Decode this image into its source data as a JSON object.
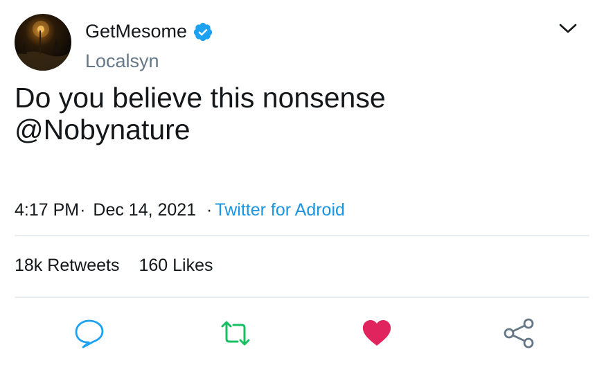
{
  "user": {
    "display_name": "GetMesome",
    "handle": "Localsyn",
    "verified": true,
    "avatar_icon": "avatar-night-street-photo"
  },
  "tweet": {
    "text_line1": "Do you believe this nonsense",
    "text_line2": "@Nobynature",
    "time": "4:17 PM",
    "date": "Dec 14, 2021",
    "source": "Twitter for Adroid"
  },
  "stats": {
    "retweets_count": "18k",
    "retweets_label": "Retweets",
    "likes_count": "160",
    "likes_label": "Likes"
  },
  "actions": {
    "reply_icon": "speech-bubble-icon",
    "retweet_icon": "retweet-arrows-icon",
    "like_icon": "heart-icon",
    "share_icon": "share-nodes-icon"
  },
  "colors": {
    "verified": "#1da1f2",
    "link": "#1b95e0",
    "handle": "#657786",
    "reply": "#1da1f2",
    "retweet": "#17bf63",
    "like": "#e0245e",
    "share": "#657786",
    "divider": "#e6ecf0"
  }
}
